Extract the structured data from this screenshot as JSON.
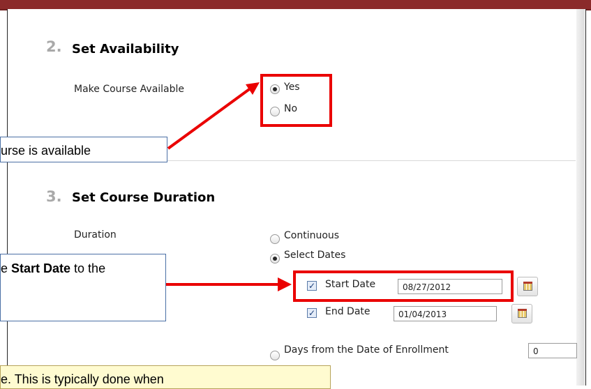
{
  "step2": {
    "number": "2.",
    "title": "Set Availability",
    "label": "Make Course Available",
    "options": [
      "Yes",
      "No"
    ],
    "selected": "Yes"
  },
  "step3": {
    "number": "3.",
    "title": "Set Course Duration",
    "label": "Duration",
    "options": [
      "Continuous",
      "Select Dates"
    ],
    "selected": "Select Dates",
    "start_label": "Start Date",
    "start_value": "08/27/2012",
    "end_label": "End Date",
    "end_value": "01/04/2013",
    "days_label": "Days from the Date of Enrollment",
    "days_value": "0"
  },
  "callouts": {
    "availability_text": "urse is available",
    "start_prefix": "e ",
    "start_bold": "Start Date",
    "start_suffix": " to the",
    "bottom_text": "e. This is typically done when"
  },
  "colors": {
    "highlight_red": "#ea0000",
    "header_bar": "#8b2a2a",
    "callout_border": "#4a6fa5",
    "note_bg": "#fffbd0"
  }
}
